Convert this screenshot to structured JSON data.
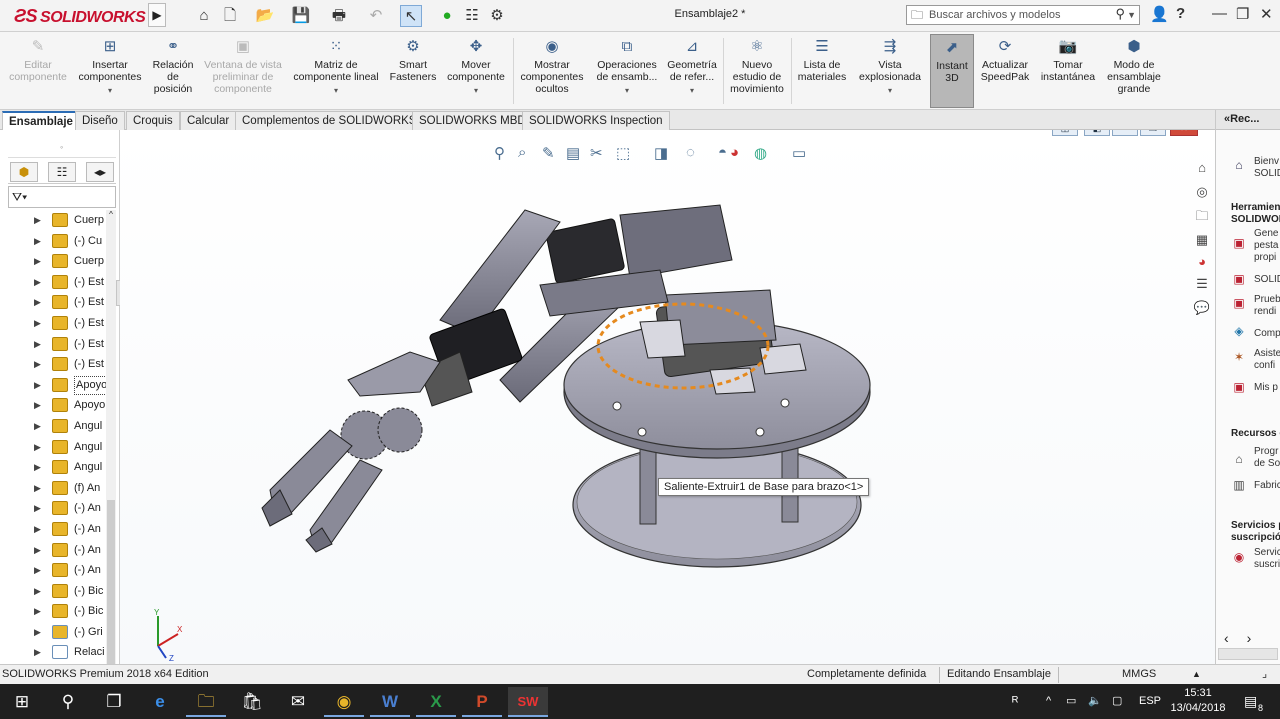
{
  "app": {
    "brand": "SOLIDWORKS",
    "document_title": "Ensamblaje2 *",
    "search_placeholder": "Buscar archivos y modelos"
  },
  "ribbon": [
    {
      "label": "Editar componente",
      "icon": "edit-component-icon",
      "disabled": true
    },
    {
      "label": "Insertar componentes",
      "icon": "insert-components-icon",
      "dropdown": true
    },
    {
      "label": "Relación de posición",
      "icon": "mate-icon"
    },
    {
      "label": "Ventana de vista preliminar de componente",
      "icon": "preview-window-icon",
      "disabled": true
    },
    {
      "label": "Matriz de componente lineal",
      "icon": "linear-pattern-icon",
      "dropdown": true
    },
    {
      "label": "Smart Fasteners",
      "icon": "smart-fasteners-icon"
    },
    {
      "label": "Mover componente",
      "icon": "move-component-icon",
      "dropdown": true
    },
    {
      "label": "Mostrar componentes ocultos",
      "icon": "show-hidden-icon"
    },
    {
      "label": "Operaciones de ensamb...",
      "icon": "assembly-features-icon",
      "dropdown": true
    },
    {
      "label": "Geometría de refer...",
      "icon": "reference-geometry-icon",
      "dropdown": true
    },
    {
      "label": "Nuevo estudio de movimiento",
      "icon": "motion-study-icon"
    },
    {
      "label": "Lista de materiales",
      "icon": "bom-icon"
    },
    {
      "label": "Vista explosionada",
      "icon": "exploded-view-icon",
      "dropdown": true
    },
    {
      "label": "Instant 3D",
      "icon": "instant3d-icon",
      "active": true
    },
    {
      "label": "Actualizar SpeedPak",
      "icon": "speedpak-icon"
    },
    {
      "label": "Tomar instantánea",
      "icon": "snapshot-icon"
    },
    {
      "label": "Modo de ensamblaje grande",
      "icon": "large-assembly-icon"
    }
  ],
  "tabs": [
    {
      "label": "Ensamblaje",
      "active": true
    },
    {
      "label": "Diseño"
    },
    {
      "label": "Croquis"
    },
    {
      "label": "Calcular"
    },
    {
      "label": "Complementos de SOLIDWORKS"
    },
    {
      "label": "SOLIDWORKS MBD"
    },
    {
      "label": "SOLIDWORKS Inspection"
    }
  ],
  "tree": {
    "items": [
      {
        "label": "Cuerp",
        "kind": "part"
      },
      {
        "label": "(-) Cu",
        "kind": "part"
      },
      {
        "label": "Cuerp",
        "kind": "part"
      },
      {
        "label": "(-) Est",
        "kind": "part"
      },
      {
        "label": "(-) Est",
        "kind": "part"
      },
      {
        "label": "(-) Est",
        "kind": "part"
      },
      {
        "label": "(-) Est",
        "kind": "part"
      },
      {
        "label": "(-) Est",
        "kind": "part"
      },
      {
        "label": "Apoyo",
        "kind": "part",
        "selected": true
      },
      {
        "label": "Apoyo",
        "kind": "part"
      },
      {
        "label": "Angul",
        "kind": "part"
      },
      {
        "label": "Angul",
        "kind": "part"
      },
      {
        "label": "Angul",
        "kind": "part"
      },
      {
        "label": "(f) An",
        "kind": "part"
      },
      {
        "label": "(-) An",
        "kind": "part"
      },
      {
        "label": "(-) An",
        "kind": "part"
      },
      {
        "label": "(-) An",
        "kind": "part"
      },
      {
        "label": "(-) An",
        "kind": "part"
      },
      {
        "label": "(-) Bic",
        "kind": "part"
      },
      {
        "label": "(-) Bic",
        "kind": "part"
      },
      {
        "label": "(-) Gri",
        "kind": "assembly"
      },
      {
        "label": "Relaci",
        "kind": "mates"
      }
    ]
  },
  "viewport": {
    "tooltip": "Saliente-Extruir1 de Base para brazo<1>"
  },
  "taskpane": {
    "title": "«Rec...",
    "welcome": [
      "Bienv",
      "SOLID"
    ],
    "section_tools": [
      "Herramien",
      "SOLIDWOR"
    ],
    "tools": [
      {
        "lines": [
          "Gene",
          "pesta",
          "propi"
        ]
      },
      {
        "lines": [
          "SOLID"
        ]
      },
      {
        "lines": [
          "Prueb",
          "rendi"
        ]
      },
      {
        "lines": [
          "Comp"
        ]
      },
      {
        "lines": [
          "Asiste",
          "confi"
        ]
      },
      {
        "lines": [
          "Mis p"
        ]
      }
    ],
    "section_resources": "Recursos c",
    "resources": [
      {
        "lines": [
          "Progr",
          "de So"
        ]
      },
      {
        "lines": [
          "Fabric"
        ]
      }
    ],
    "section_services": [
      "Servicios p",
      "suscripción"
    ],
    "services": [
      {
        "lines": [
          "Servic",
          "suscri"
        ]
      }
    ]
  },
  "status": {
    "edition": "SOLIDWORKS Premium 2018 x64 Edition",
    "definition": "Completamente definida",
    "mode": "Editando Ensamblaje",
    "units": "MMGS"
  },
  "taskbar": {
    "language": "ESP",
    "time": "15:31",
    "date": "13/04/2018",
    "notification_count": "8"
  },
  "colors": {
    "accent": "#c8102e",
    "selection": "#2b6cb5",
    "highlight": "#e58a1f"
  }
}
